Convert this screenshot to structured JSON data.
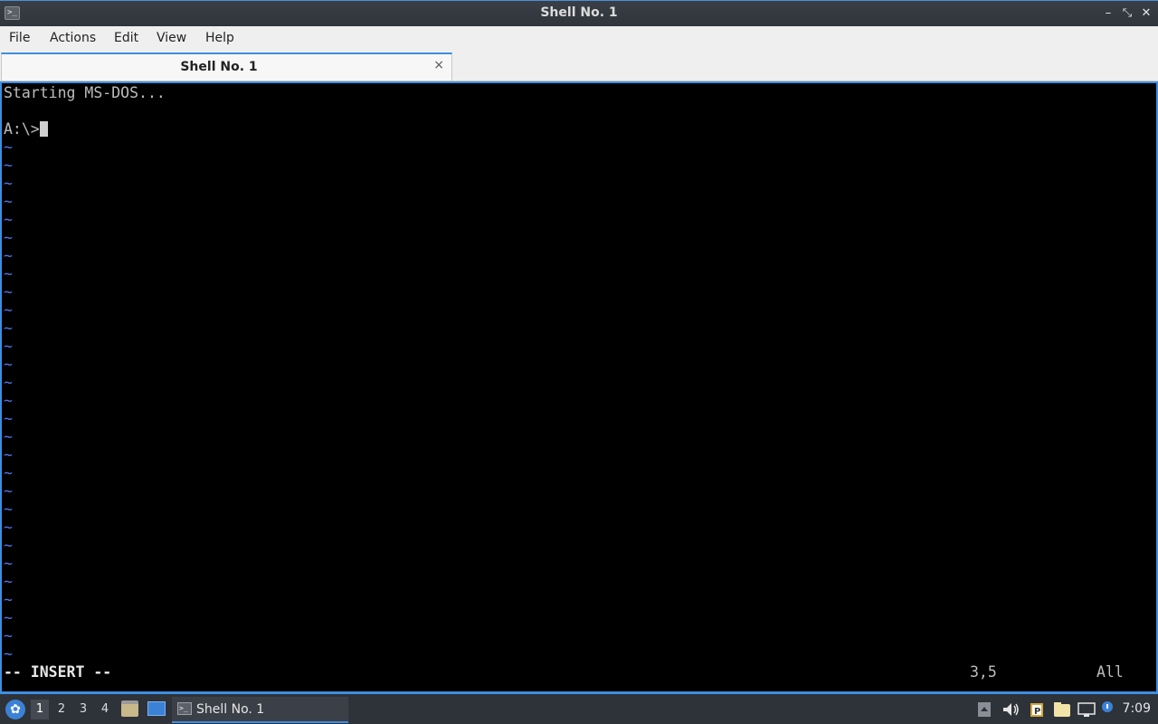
{
  "window": {
    "title": "Shell No. 1",
    "app_icon": ">_",
    "minimize": "–",
    "maximize": "⤡",
    "close": "✕"
  },
  "menu": [
    "File",
    "Actions",
    "Edit",
    "View",
    "Help"
  ],
  "tabs": [
    {
      "label": "Shell No. 1",
      "close": "×",
      "active": true
    }
  ],
  "terminal": {
    "lines": [
      "Starting MS-DOS...",
      "",
      "A:\\>"
    ],
    "empty_line_marker": "~",
    "empty_line_count": 29,
    "mode": "-- INSERT --",
    "position": "3,5",
    "scroll": "All",
    "colors": {
      "background": "#000000",
      "text": "#bdbdbd",
      "tilde": "#4f74e8"
    }
  },
  "taskbar": {
    "workspaces": [
      "1",
      "2",
      "3",
      "4"
    ],
    "active_workspace": "1",
    "task": {
      "label": "Shell No. 1",
      "icon": "terminal-icon"
    },
    "tray_icons": [
      "notification-area-icon",
      "volume-icon",
      "clipboard-icon",
      "file-manager-icon",
      "network-icon",
      "info-icon"
    ],
    "clock": "7:09"
  },
  "accent_color": "#3d8ee0"
}
